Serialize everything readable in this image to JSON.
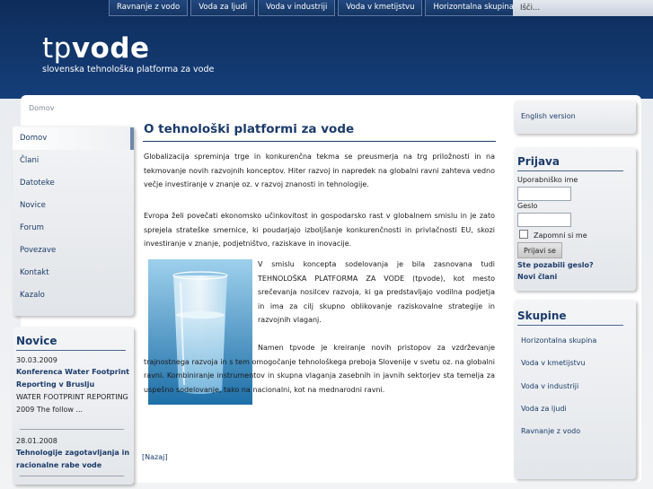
{
  "topnav": {
    "items": [
      "Ravnanje z vodo",
      "Voda za ljudi",
      "Voda v industriji",
      "Voda v kmetijstvu",
      "Horizontalna skupina"
    ],
    "search_placeholder": "Išči..."
  },
  "header": {
    "logo_part1": "tp",
    "logo_part2": "vode",
    "tagline": "slovenska tehnološka platforma za vode"
  },
  "breadcrumb": "Domov",
  "leftmenu": {
    "items": [
      "Domov",
      "Člani",
      "Datoteke",
      "Novice",
      "Forum",
      "Povezave",
      "Kontakt",
      "Kazalo"
    ]
  },
  "novice": {
    "title": "Novice",
    "entries": [
      {
        "date": "30.03.2009",
        "headline": "Konferenca Water Footprint Reporting v Bruslju",
        "excerpt": "WATER FOOTPRINT REPORTING 2009 The follow ..."
      },
      {
        "date": "28.01.2008",
        "headline": "Tehnologije zagotavljanja in racionalne rabe vode"
      }
    ]
  },
  "content": {
    "title": "O tehnološki platformi za vode",
    "para1": "Globalizacija spreminja trge in konkurenčna tekma se preusmerja na trg priložnosti in na tekmovanje novih razvojnih konceptov. Hiter razvoj in napredek na globalni ravni zahteva vedno večje investiranje v znanje oz. v razvoj znanosti in tehnologije.",
    "para2": "Evropa želi povečati ekonomsko učinkovitost in gospodarsko rast v globalnem smislu in je zato sprejela strateške smernice, ki poudarjajo izboljšanje konkurenčnosti in privlačnosti EU, skozi investiranje v znanje, podjetništvo, raziskave in inovacije.",
    "para3": "V smislu koncepta sodelovanja je bila zasnovana tudi TEHNOLOŠKA PLATFORMA ZA VODE (tpvode), kot mesto srečevanja nosilcev razvoja, ki ga predstavljajo vodilna podjetja in ima za cilj skupno oblikovanje raziskovalne strategije in razvojnih vlaganj.",
    "para4": "Namen tpvode je kreiranje novih pristopov za vzdrževanje trajnostnega razvoja in s tem omogočanje tehnološkega preboja Slovenije v svetu oz. na globalni ravni. Kombiniranje instrumentov in skupna vlaganja zasebnih in javnih sektorjev sta temelja za uspešno sodelovanje, tako na nacionalni, kot na mednarodni ravni.",
    "back_link": "[Nazaj]"
  },
  "right": {
    "english_link": "English version",
    "prijava": {
      "title": "Prijava",
      "username_label": "Uporabniško ime",
      "password_label": "Geslo",
      "remember_label": "Zapomni si me",
      "login_button": "Prijavi se",
      "forgot_link": "Ste pozabili geslo?",
      "new_members_link": "Novi člani"
    },
    "skupine": {
      "title": "Skupine",
      "items": [
        "Horizontalna skupina",
        "Voda v kmetijstvu",
        "Voda v industriji",
        "Voda za ljudi",
        "Ravnanje z vodo"
      ]
    }
  }
}
